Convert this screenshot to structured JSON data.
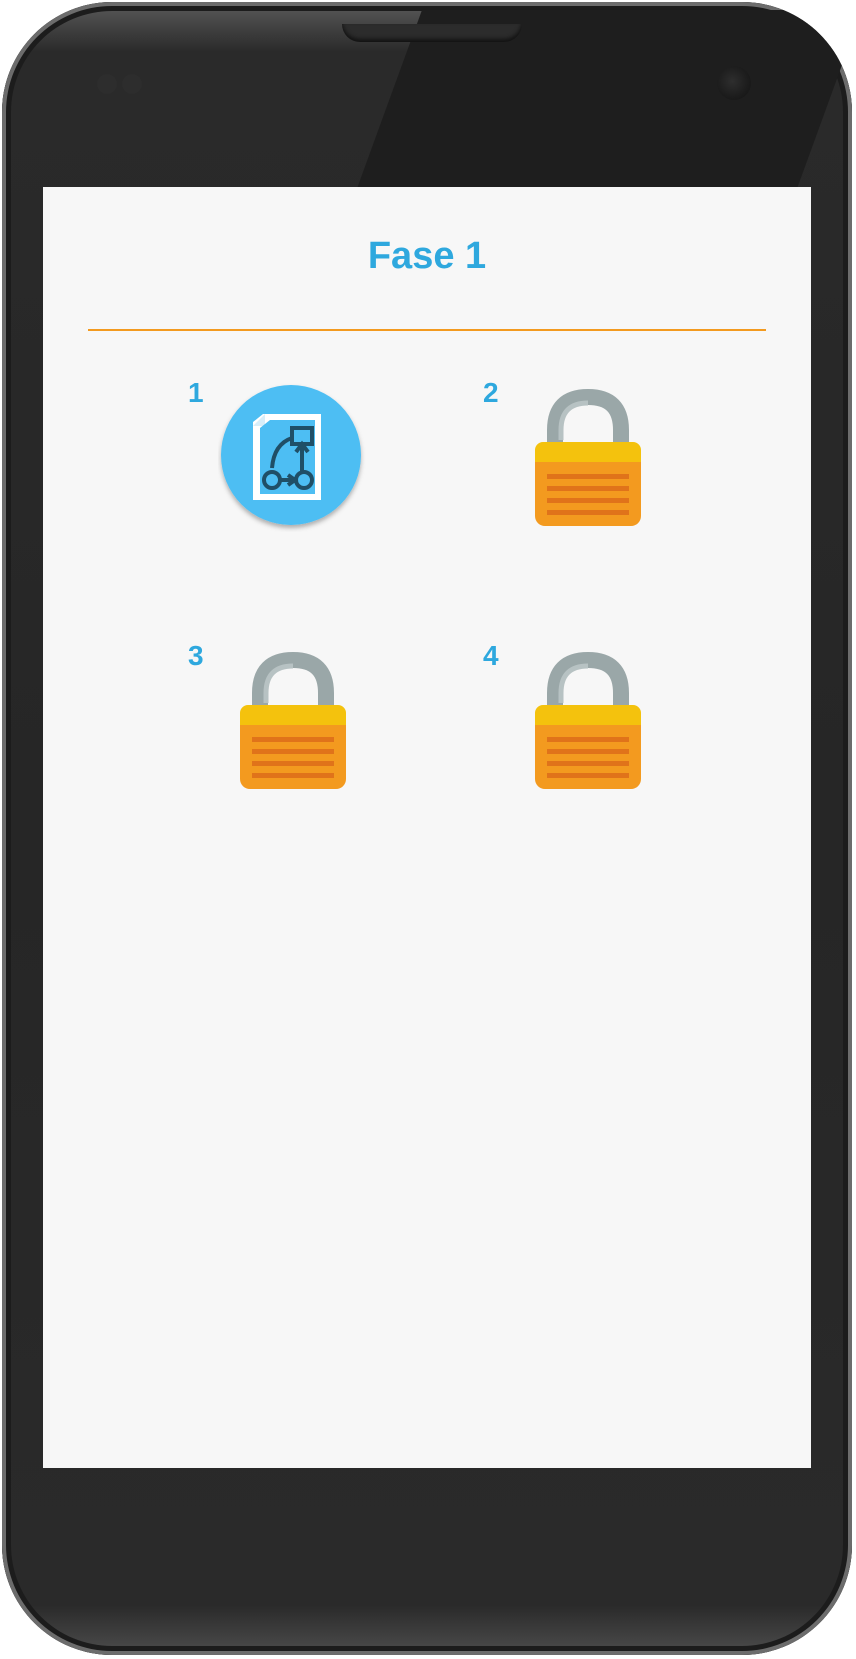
{
  "screen": {
    "title": "Fase 1"
  },
  "levels": [
    {
      "number": "1",
      "state": "unlocked",
      "icon": "flowchart-document-icon"
    },
    {
      "number": "2",
      "state": "locked",
      "icon": "padlock-icon"
    },
    {
      "number": "3",
      "state": "locked",
      "icon": "padlock-icon"
    },
    {
      "number": "4",
      "state": "locked",
      "icon": "padlock-icon"
    }
  ],
  "colors": {
    "accent": "#2ea8de",
    "divider": "#f39a1f",
    "lock_body": "#f39a1f",
    "lock_shackle": "#9aa7a8",
    "unlocked_badge": "#4dbef3",
    "screen_background": "#f7f7f7"
  }
}
